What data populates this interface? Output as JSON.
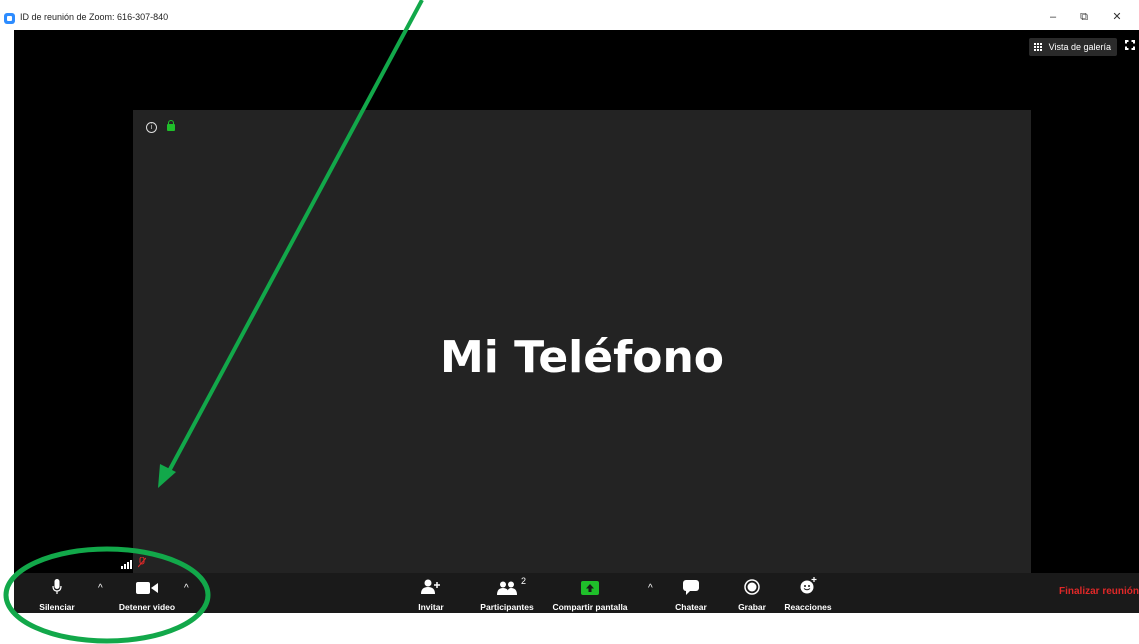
{
  "window": {
    "title": "ID de reunión de Zoom: 616-307-840",
    "minimize": "–",
    "restore": "⧉",
    "close": "✕"
  },
  "top_controls": {
    "gallery_view": "Vista de galería"
  },
  "video": {
    "participant_name": "Mi Teléfono"
  },
  "toolbar": {
    "mute": "Silenciar",
    "stop_video": "Detener video",
    "invite": "Invitar",
    "participants": "Participantes",
    "participants_count": "2",
    "share_screen": "Compartir pantalla",
    "chat": "Chatear",
    "record": "Grabar",
    "reactions": "Reacciones",
    "end_meeting": "Finalizar reunión"
  },
  "colors": {
    "accent_green": "#1fbf2a",
    "end_red": "#e02828",
    "annotation_green": "#12a84a",
    "zoom_blue": "#2D8CFF"
  }
}
